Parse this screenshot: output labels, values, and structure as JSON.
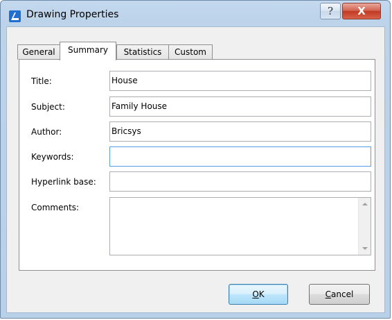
{
  "window": {
    "title": "Drawing Properties",
    "help_glyph": "?",
    "close_glyph": "X"
  },
  "tabs": [
    {
      "label": "General",
      "active": false
    },
    {
      "label": "Summary",
      "active": true
    },
    {
      "label": "Statistics",
      "active": false
    },
    {
      "label": "Custom",
      "active": false
    }
  ],
  "form": {
    "title_label": "Title:",
    "title_value": "House",
    "subject_label": "Subject:",
    "subject_value": "Family House",
    "author_label": "Author:",
    "author_value": "Bricsys",
    "keywords_label": "Keywords:",
    "keywords_value": "",
    "hyperlink_label": "Hyperlink base:",
    "hyperlink_value": "",
    "comments_label": "Comments:",
    "comments_value": ""
  },
  "buttons": {
    "ok_prefix": "",
    "ok_mnemonic": "O",
    "ok_rest": "K",
    "cancel_mnemonic": "C",
    "cancel_rest": "ancel"
  },
  "icons": {
    "app": "bricscad-app-icon",
    "help": "help-icon",
    "close": "close-icon",
    "scroll_up": "scroll-up-arrow-icon",
    "scroll_down": "scroll-down-arrow-icon"
  },
  "colors": {
    "title_bar": "#bcd3ea",
    "close_button": "#c13a22",
    "focus_border": "#569de5",
    "app_icon": "#1e6fd0"
  }
}
